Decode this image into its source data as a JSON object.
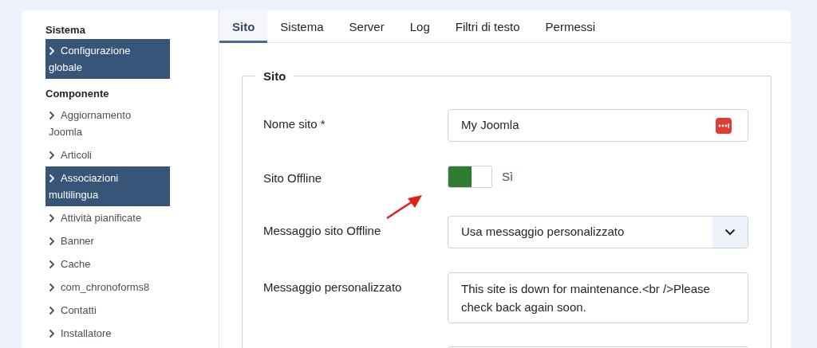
{
  "sidebar": {
    "sections": [
      {
        "title": "Sistema",
        "items": [
          {
            "label": "Configurazione globale",
            "selected": true
          }
        ]
      },
      {
        "title": "Componente",
        "items": [
          {
            "label": "Aggiornamento Joomla",
            "selected": false
          },
          {
            "label": "Articoli",
            "selected": false
          },
          {
            "label": "Associazioni multilingua",
            "selected": true
          },
          {
            "label": "Attività pianificate",
            "selected": false
          },
          {
            "label": "Banner",
            "selected": false
          },
          {
            "label": "Cache",
            "selected": false
          },
          {
            "label": "com_chronoforms8",
            "selected": false
          },
          {
            "label": "Contatti",
            "selected": false
          },
          {
            "label": "Installatore",
            "selected": false
          }
        ]
      }
    ]
  },
  "tabs": [
    {
      "label": "Sito",
      "selected": true
    },
    {
      "label": "Sistema",
      "selected": false
    },
    {
      "label": "Server",
      "selected": false
    },
    {
      "label": "Log",
      "selected": false
    },
    {
      "label": "Filtri di testo",
      "selected": false
    },
    {
      "label": "Permessi",
      "selected": false
    }
  ],
  "fieldset": {
    "legend": "Sito",
    "fields": [
      {
        "kind": "text",
        "label": "Nome sito *",
        "value": "My Joomla"
      },
      {
        "kind": "switch",
        "label": "Sito Offline",
        "on": true,
        "state_label": "Sì"
      },
      {
        "kind": "select",
        "label": "Messaggio sito Offline",
        "value": "Usa messaggio personalizzato"
      },
      {
        "kind": "textarea",
        "label": "Messaggio personalizzato",
        "value": "This site is down for maintenance.<br />Please check back again soon."
      }
    ]
  }
}
